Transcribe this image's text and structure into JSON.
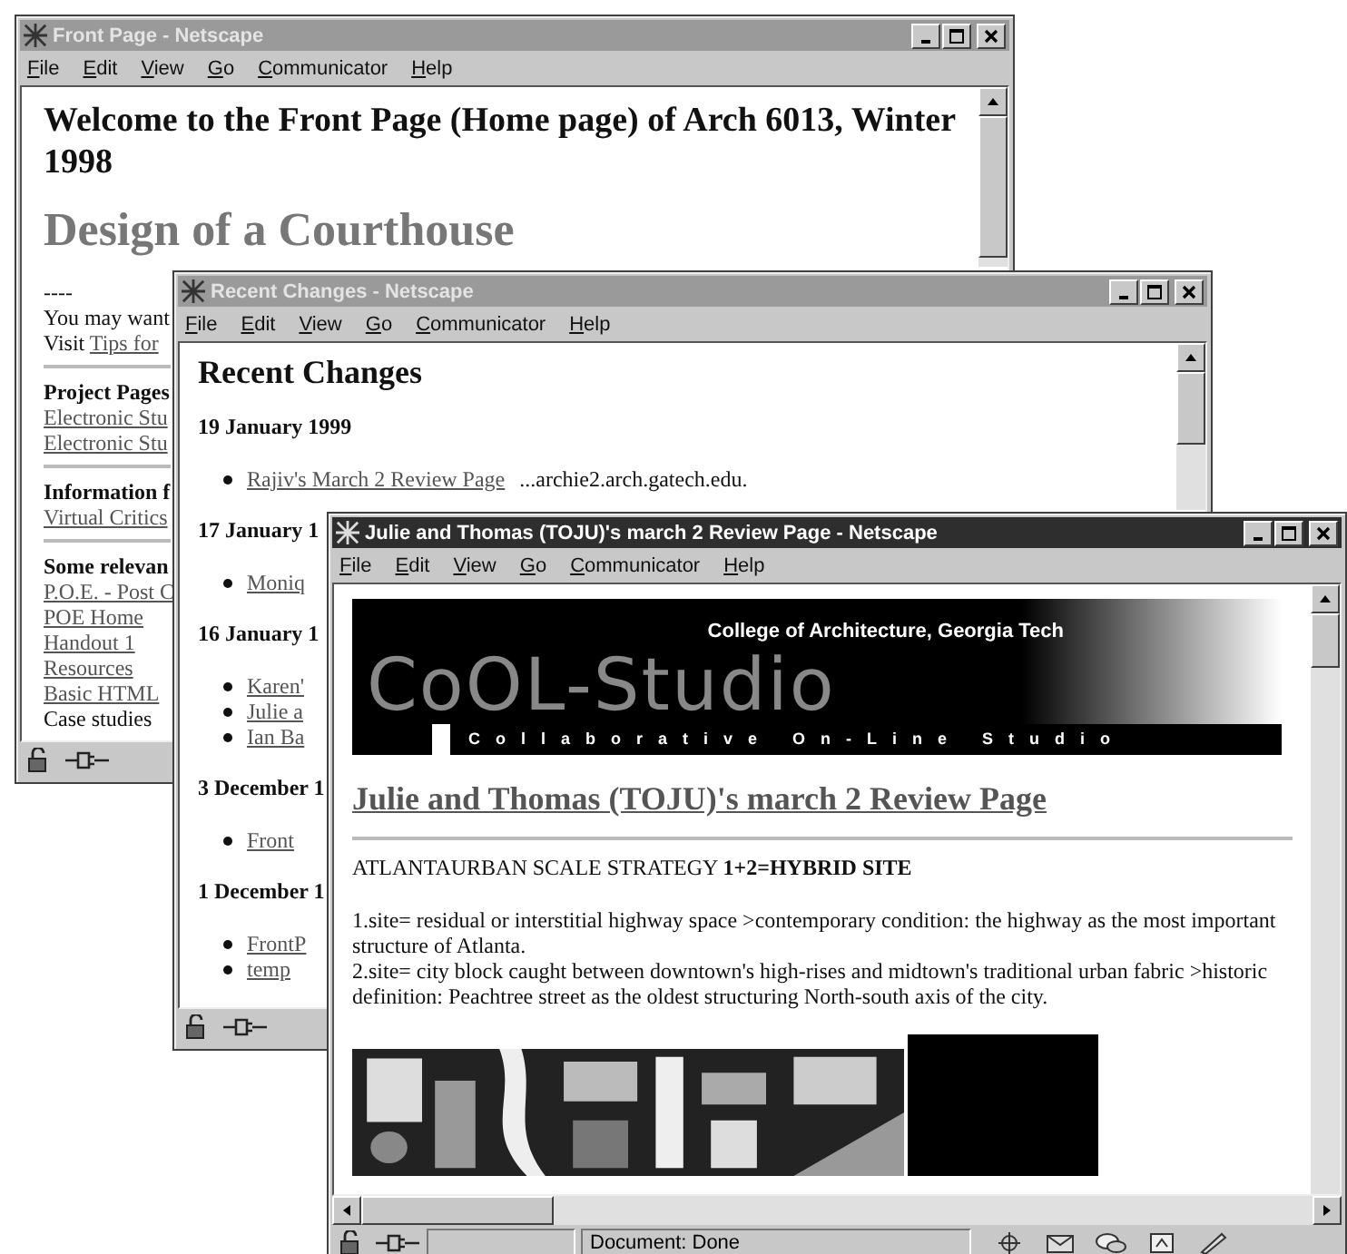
{
  "front_page": {
    "title": "Front Page - Netscape",
    "active": false,
    "menu": [
      "File",
      "Edit",
      "View",
      "Go",
      "Communicator",
      "Help"
    ],
    "heading": "Welcome to the Front Page (Home page) of Arch 6013, Winter 1998",
    "subheading": "Design of a Courthouse",
    "blocks": [
      {
        "kind": "text",
        "text": "----"
      },
      {
        "kind": "text",
        "text": "You may want"
      },
      {
        "kind": "text-link",
        "text": "Visit",
        "link": "Tips for"
      },
      {
        "kind": "rule"
      },
      {
        "kind": "bold",
        "text": "Project Pages"
      },
      {
        "kind": "link",
        "text": "Electronic Stu"
      },
      {
        "kind": "link",
        "text": "Electronic Stu"
      },
      {
        "kind": "rule"
      },
      {
        "kind": "bold",
        "text": "Information f"
      },
      {
        "kind": "link",
        "text": "Virtual Critics"
      },
      {
        "kind": "rule"
      },
      {
        "kind": "bold",
        "text": "Some relevan"
      },
      {
        "kind": "link",
        "text": "P.O.E. - Post C"
      },
      {
        "kind": "link",
        "text": "POE Home"
      },
      {
        "kind": "link",
        "text": "Handout 1"
      },
      {
        "kind": "link",
        "text": "Resources"
      },
      {
        "kind": "link",
        "text": "Basic HTML"
      },
      {
        "kind": "text",
        "text": "Case studies"
      }
    ]
  },
  "recent_changes": {
    "title": "Recent Changes - Netscape",
    "active": false,
    "menu": [
      "File",
      "Edit",
      "View",
      "Go",
      "Communicator",
      "Help"
    ],
    "heading": "Recent Changes",
    "sections": [
      {
        "date": "19 January 1999",
        "items": [
          {
            "link": "Rajiv's March 2 Review Page",
            "note": "...archie2.arch.gatech.edu."
          }
        ]
      },
      {
        "date": "17 January 1",
        "items": [
          {
            "link": "Moniq"
          }
        ]
      },
      {
        "date": "16 January 1",
        "items": [
          {
            "link": "Karen'"
          },
          {
            "link": "Julie a"
          },
          {
            "link": "Ian Ba"
          }
        ]
      },
      {
        "date": "3 December 1",
        "items": [
          {
            "link": "Front"
          }
        ]
      },
      {
        "date": "1 December 1",
        "items": [
          {
            "link": "FrontP"
          },
          {
            "link": "temp"
          }
        ]
      }
    ]
  },
  "review_page": {
    "title": "Julie and Thomas (TOJU)'s march 2 Review Page - Netscape",
    "active": true,
    "menu": [
      "File",
      "Edit",
      "View",
      "Go",
      "Communicator",
      "Help"
    ],
    "banner": {
      "subtitle": "College of Architecture, Georgia Tech",
      "logo": "CoOL-Studio",
      "tagline": "Collaborative On-Line Studio"
    },
    "heading": "Julie and Thomas (TOJU)'s march 2 Review Page",
    "strategy": "ATLANTAURBAN SCALE STRATEGY **1+2=HYBRID SITE**",
    "paragraphs": [
      "1.site= residual or interstitial highway space >contemporary condition: the highway as the most important structure of Atlanta.",
      "2.site= city block caught between downtown's high-rises and midtown's traditional urban fabric >historic definition: Peachtree street as the oldest structuring North-south axis of the city."
    ],
    "status": "Document: Done"
  }
}
